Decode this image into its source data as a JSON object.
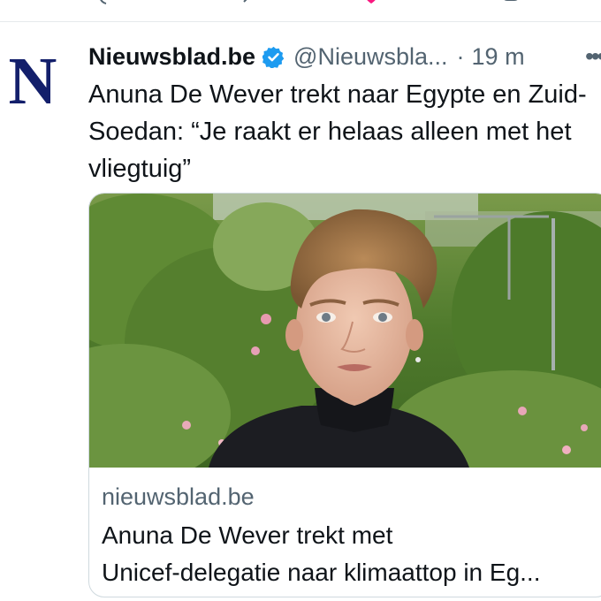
{
  "tweet": {
    "account_name": "Nieuwsblad.be",
    "handle": "@Nieuwsbla...",
    "separator": "·",
    "time": "19 m",
    "avatar_letter": "N",
    "text": "Anuna De Wever trekt naar Egypte en Zuid-Soedan: “Je raakt er helaas alleen met het vliegtuig”",
    "verified_icon": "verified-badge-icon",
    "more_icon": "more-options-icon"
  },
  "card": {
    "domain": "nieuwsblad.be",
    "title_line1": "Anuna De Wever trekt met",
    "title_line2": "Unicef-delegatie naar klimaattop in Eg..."
  },
  "colors": {
    "brand_navy": "#131f6b",
    "verified_blue": "#1d9bf0",
    "secondary_text": "#536471",
    "border": "#cfd9de"
  }
}
